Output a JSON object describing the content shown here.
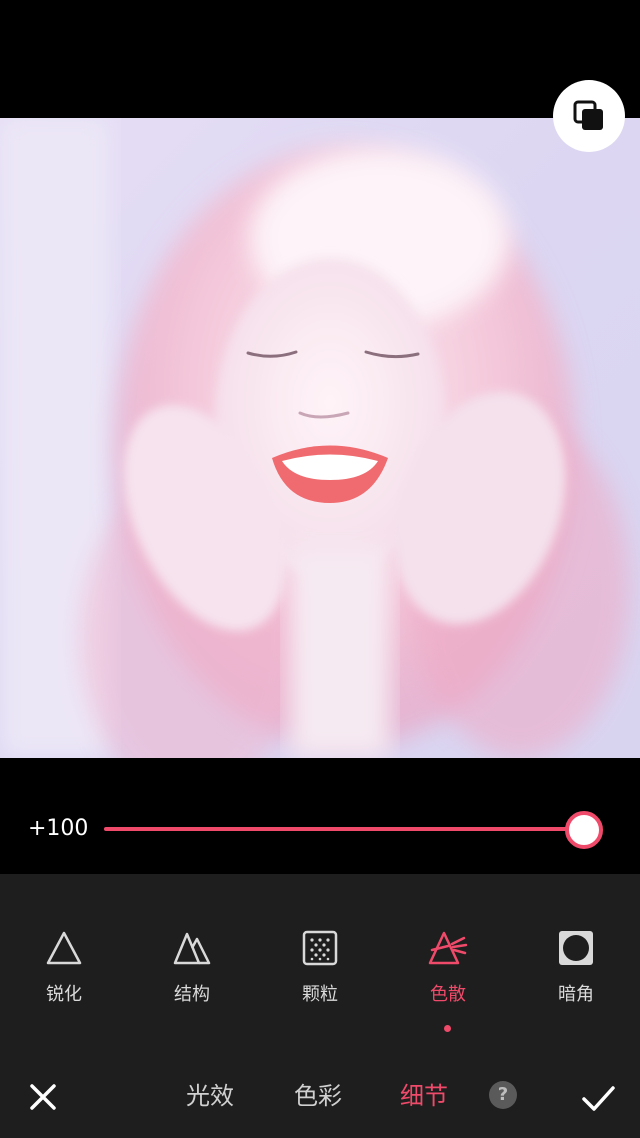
{
  "slider": {
    "value_label": "+100",
    "level": 1.0
  },
  "tools": [
    {
      "label": "锐化",
      "icon": "triangle-icon"
    },
    {
      "label": "结构",
      "icon": "mountains-icon"
    },
    {
      "label": "颗粒",
      "icon": "grain-icon"
    },
    {
      "label": "色散",
      "icon": "prism-icon",
      "active": true
    },
    {
      "label": "暗角",
      "icon": "vignette-icon"
    }
  ],
  "tabs": {
    "light": "光效",
    "color": "色彩",
    "detail": "细节"
  },
  "help_label": "?",
  "accent_color": "#f04a6a"
}
